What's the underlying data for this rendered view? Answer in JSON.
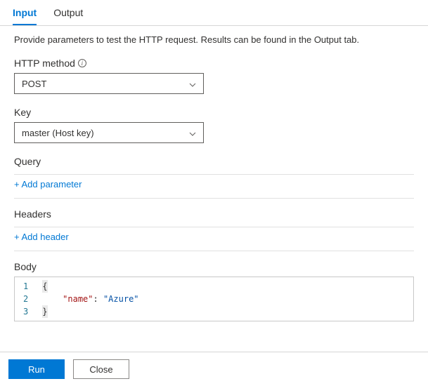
{
  "tabs": {
    "input": "Input",
    "output": "Output"
  },
  "description": "Provide parameters to test the HTTP request. Results can be found in the Output tab.",
  "httpMethod": {
    "label": "HTTP method",
    "value": "POST"
  },
  "key": {
    "label": "Key",
    "value": "master (Host key)"
  },
  "query": {
    "label": "Query",
    "addLabel": "+ Add parameter"
  },
  "headers": {
    "label": "Headers",
    "addLabel": "+ Add header"
  },
  "body": {
    "label": "Body",
    "lines": [
      "1",
      "2",
      "3"
    ],
    "code": {
      "l1": "{",
      "l2_key": "\"name\"",
      "l2_colon": ": ",
      "l2_val": "\"Azure\"",
      "l3": "}"
    },
    "indent": "    "
  },
  "footer": {
    "run": "Run",
    "close": "Close"
  }
}
